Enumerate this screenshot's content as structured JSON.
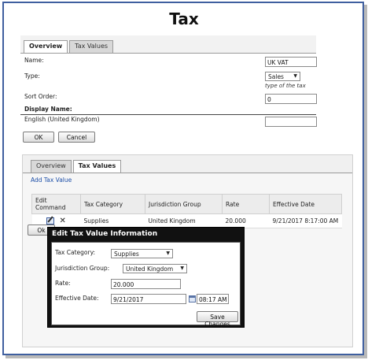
{
  "title": "Tax",
  "overview_panel": {
    "tabs": [
      {
        "label": "Overview"
      },
      {
        "label": "Tax Values"
      }
    ],
    "name_label": "Name:",
    "name_value": "UK VAT",
    "type_label": "Type:",
    "type_value": "Sales",
    "type_hint": "type of the tax",
    "sort_order_label": "Sort Order:",
    "sort_order_value": "0",
    "display_name_label": "Display Name:",
    "language_label": "English (United Kingdom)",
    "language_value": "",
    "ok_label": "OK",
    "cancel_label": "Cancel"
  },
  "values_panel": {
    "tabs": [
      {
        "label": "Overview"
      },
      {
        "label": "Tax Values"
      }
    ],
    "add_link": "Add Tax Value",
    "columns": [
      "Edit Command",
      "Tax Category",
      "Jurisdiction Group",
      "Rate",
      "Effective Date"
    ],
    "rows": [
      {
        "category": "Supplies",
        "jurisdiction": "United Kingdom",
        "rate": "20.000",
        "effective_date": "9/21/2017 8:17:00 AM"
      }
    ],
    "ok_partial": "Ok"
  },
  "dialog": {
    "title": "Edit Tax Value Information",
    "tax_category_label": "Tax Category:",
    "tax_category_value": "Supplies",
    "jurisdiction_label": "Jurisdiction Group:",
    "jurisdiction_value": "United Kingdom",
    "rate_label": "Rate:",
    "rate_value": "20.000",
    "effective_date_label": "Effective Date:",
    "effective_date_value": "9/21/2017",
    "effective_time_value": "08:17 AM",
    "save_label": "Save Changes"
  },
  "colors": {
    "frame_border": "#3f5f9f",
    "link": "#1d4fa8",
    "dialog_bg": "#111111"
  }
}
